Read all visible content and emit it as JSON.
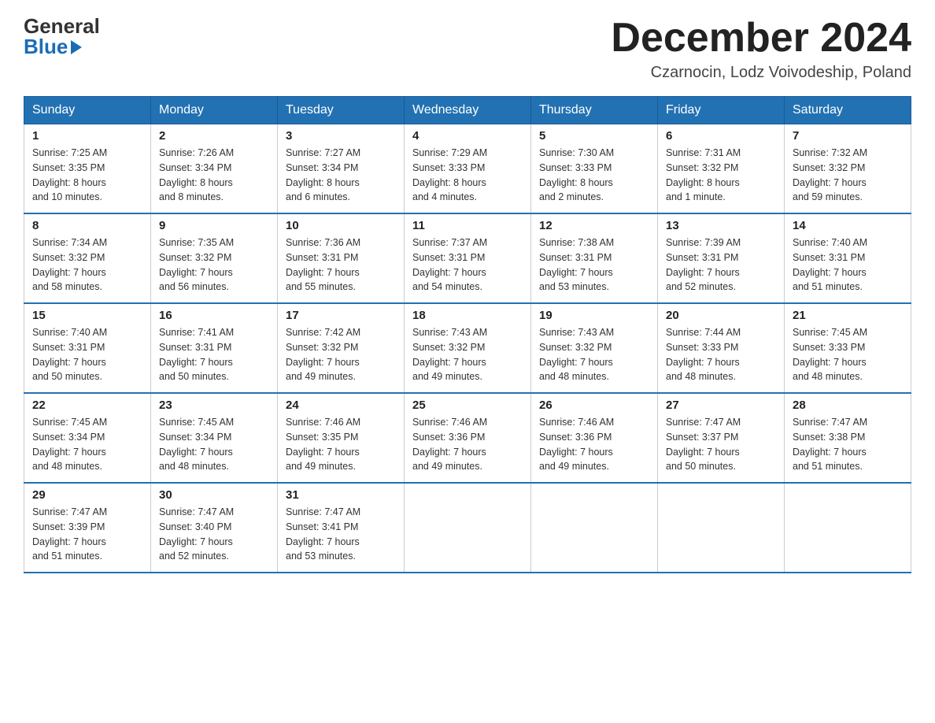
{
  "header": {
    "logo_general": "General",
    "logo_blue": "Blue",
    "month_title": "December 2024",
    "subtitle": "Czarnocin, Lodz Voivodeship, Poland"
  },
  "days_of_week": [
    "Sunday",
    "Monday",
    "Tuesday",
    "Wednesday",
    "Thursday",
    "Friday",
    "Saturday"
  ],
  "weeks": [
    [
      {
        "day": "1",
        "info": "Sunrise: 7:25 AM\nSunset: 3:35 PM\nDaylight: 8 hours\nand 10 minutes."
      },
      {
        "day": "2",
        "info": "Sunrise: 7:26 AM\nSunset: 3:34 PM\nDaylight: 8 hours\nand 8 minutes."
      },
      {
        "day": "3",
        "info": "Sunrise: 7:27 AM\nSunset: 3:34 PM\nDaylight: 8 hours\nand 6 minutes."
      },
      {
        "day": "4",
        "info": "Sunrise: 7:29 AM\nSunset: 3:33 PM\nDaylight: 8 hours\nand 4 minutes."
      },
      {
        "day": "5",
        "info": "Sunrise: 7:30 AM\nSunset: 3:33 PM\nDaylight: 8 hours\nand 2 minutes."
      },
      {
        "day": "6",
        "info": "Sunrise: 7:31 AM\nSunset: 3:32 PM\nDaylight: 8 hours\nand 1 minute."
      },
      {
        "day": "7",
        "info": "Sunrise: 7:32 AM\nSunset: 3:32 PM\nDaylight: 7 hours\nand 59 minutes."
      }
    ],
    [
      {
        "day": "8",
        "info": "Sunrise: 7:34 AM\nSunset: 3:32 PM\nDaylight: 7 hours\nand 58 minutes."
      },
      {
        "day": "9",
        "info": "Sunrise: 7:35 AM\nSunset: 3:32 PM\nDaylight: 7 hours\nand 56 minutes."
      },
      {
        "day": "10",
        "info": "Sunrise: 7:36 AM\nSunset: 3:31 PM\nDaylight: 7 hours\nand 55 minutes."
      },
      {
        "day": "11",
        "info": "Sunrise: 7:37 AM\nSunset: 3:31 PM\nDaylight: 7 hours\nand 54 minutes."
      },
      {
        "day": "12",
        "info": "Sunrise: 7:38 AM\nSunset: 3:31 PM\nDaylight: 7 hours\nand 53 minutes."
      },
      {
        "day": "13",
        "info": "Sunrise: 7:39 AM\nSunset: 3:31 PM\nDaylight: 7 hours\nand 52 minutes."
      },
      {
        "day": "14",
        "info": "Sunrise: 7:40 AM\nSunset: 3:31 PM\nDaylight: 7 hours\nand 51 minutes."
      }
    ],
    [
      {
        "day": "15",
        "info": "Sunrise: 7:40 AM\nSunset: 3:31 PM\nDaylight: 7 hours\nand 50 minutes."
      },
      {
        "day": "16",
        "info": "Sunrise: 7:41 AM\nSunset: 3:31 PM\nDaylight: 7 hours\nand 50 minutes."
      },
      {
        "day": "17",
        "info": "Sunrise: 7:42 AM\nSunset: 3:32 PM\nDaylight: 7 hours\nand 49 minutes."
      },
      {
        "day": "18",
        "info": "Sunrise: 7:43 AM\nSunset: 3:32 PM\nDaylight: 7 hours\nand 49 minutes."
      },
      {
        "day": "19",
        "info": "Sunrise: 7:43 AM\nSunset: 3:32 PM\nDaylight: 7 hours\nand 48 minutes."
      },
      {
        "day": "20",
        "info": "Sunrise: 7:44 AM\nSunset: 3:33 PM\nDaylight: 7 hours\nand 48 minutes."
      },
      {
        "day": "21",
        "info": "Sunrise: 7:45 AM\nSunset: 3:33 PM\nDaylight: 7 hours\nand 48 minutes."
      }
    ],
    [
      {
        "day": "22",
        "info": "Sunrise: 7:45 AM\nSunset: 3:34 PM\nDaylight: 7 hours\nand 48 minutes."
      },
      {
        "day": "23",
        "info": "Sunrise: 7:45 AM\nSunset: 3:34 PM\nDaylight: 7 hours\nand 48 minutes."
      },
      {
        "day": "24",
        "info": "Sunrise: 7:46 AM\nSunset: 3:35 PM\nDaylight: 7 hours\nand 49 minutes."
      },
      {
        "day": "25",
        "info": "Sunrise: 7:46 AM\nSunset: 3:36 PM\nDaylight: 7 hours\nand 49 minutes."
      },
      {
        "day": "26",
        "info": "Sunrise: 7:46 AM\nSunset: 3:36 PM\nDaylight: 7 hours\nand 49 minutes."
      },
      {
        "day": "27",
        "info": "Sunrise: 7:47 AM\nSunset: 3:37 PM\nDaylight: 7 hours\nand 50 minutes."
      },
      {
        "day": "28",
        "info": "Sunrise: 7:47 AM\nSunset: 3:38 PM\nDaylight: 7 hours\nand 51 minutes."
      }
    ],
    [
      {
        "day": "29",
        "info": "Sunrise: 7:47 AM\nSunset: 3:39 PM\nDaylight: 7 hours\nand 51 minutes."
      },
      {
        "day": "30",
        "info": "Sunrise: 7:47 AM\nSunset: 3:40 PM\nDaylight: 7 hours\nand 52 minutes."
      },
      {
        "day": "31",
        "info": "Sunrise: 7:47 AM\nSunset: 3:41 PM\nDaylight: 7 hours\nand 53 minutes."
      },
      {
        "day": "",
        "info": ""
      },
      {
        "day": "",
        "info": ""
      },
      {
        "day": "",
        "info": ""
      },
      {
        "day": "",
        "info": ""
      }
    ]
  ]
}
